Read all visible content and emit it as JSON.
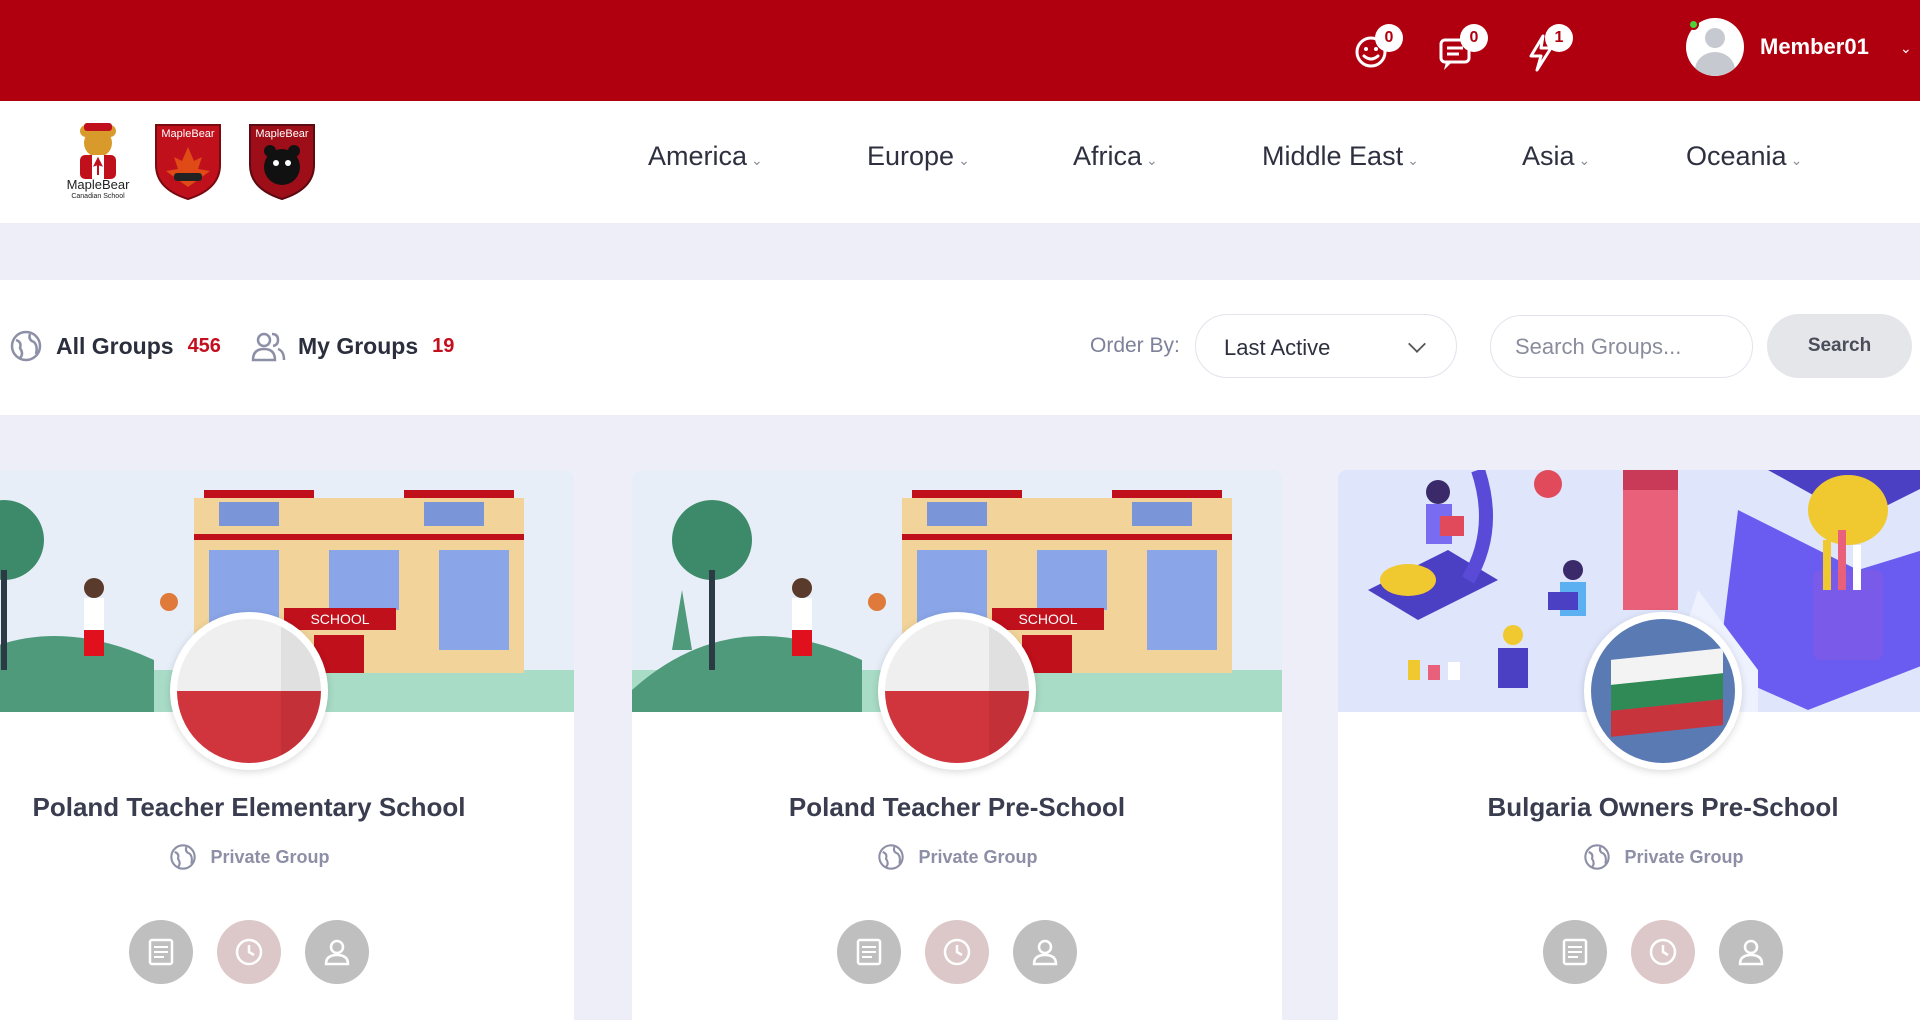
{
  "topbar": {
    "notices_count": "0",
    "messages_count": "0",
    "alerts_count": "1",
    "user_name": "Member01",
    "bg_color": "#b00010"
  },
  "logos": {
    "logo1_text": "MapleBear",
    "logo1_sub": "Canadian School",
    "logo2_text": "MapleBear",
    "logo3_text": "MapleBear"
  },
  "nav": {
    "items": [
      {
        "label": "America"
      },
      {
        "label": "Europe"
      },
      {
        "label": "Africa"
      },
      {
        "label": "Middle East"
      },
      {
        "label": "Asia"
      },
      {
        "label": "Oceania"
      }
    ]
  },
  "filters": {
    "all_groups_label": "All Groups",
    "all_groups_count": "456",
    "my_groups_label": "My Groups",
    "my_groups_count": "19",
    "order_by_label": "Order By:",
    "order_by_value": "Last Active",
    "search_placeholder": "Search Groups...",
    "search_button": "Search"
  },
  "groups": [
    {
      "title": "Poland Teacher Elementary School",
      "type": "Private Group",
      "flag": "poland",
      "cover": "school"
    },
    {
      "title": "Poland Teacher Pre-School",
      "type": "Private Group",
      "flag": "poland",
      "cover": "school"
    },
    {
      "title": "Bulgaria Owners Pre-School",
      "type": "Private Group",
      "flag": "bulgaria",
      "cover": "education"
    }
  ],
  "icons": {
    "notices": "smile-icon",
    "messages": "chat-icon",
    "alerts": "bolt-icon",
    "all_groups": "globe-icon",
    "my_groups": "users-icon",
    "action_1": "feed-icon",
    "action_2": "clock-icon",
    "action_3": "user-icon"
  },
  "colors": {
    "accent": "#c4101e",
    "page_bg": "#edeef8",
    "muted_text": "#8d8fa6"
  }
}
